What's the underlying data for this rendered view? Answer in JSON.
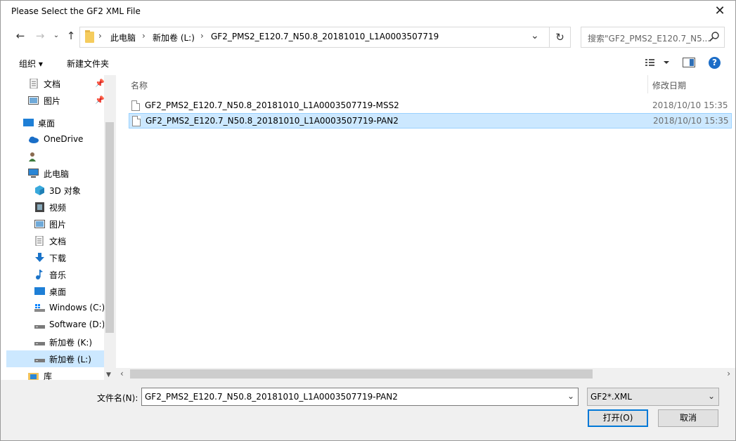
{
  "window": {
    "title": "Please Select the GF2 XML File"
  },
  "address": {
    "crumbs": [
      "此电脑",
      "新加卷 (L:)",
      "GF2_PMS2_E120.7_N50.8_20181010_L1A0003507719"
    ],
    "separator": "›",
    "search_placeholder": "搜索\"GF2_PMS2_E120.7_N5..."
  },
  "toolbar": {
    "organize": "组织 ▾",
    "new_folder": "新建文件夹"
  },
  "sidebar": {
    "items": [
      {
        "label": "文档",
        "icon": "document-icon",
        "pinned": true
      },
      {
        "label": "图片",
        "icon": "pictures-icon",
        "pinned": true
      },
      {
        "label": "桌面",
        "icon": "desktop-icon"
      },
      {
        "label": "OneDrive",
        "icon": "onedrive-icon"
      },
      {
        "label": "",
        "icon": "user-icon"
      },
      {
        "label": "此电脑",
        "icon": "this-pc-icon"
      },
      {
        "label": "3D 对象",
        "icon": "3d-objects-icon"
      },
      {
        "label": "视频",
        "icon": "videos-icon"
      },
      {
        "label": "图片",
        "icon": "pictures-icon"
      },
      {
        "label": "文档",
        "icon": "document-icon"
      },
      {
        "label": "下载",
        "icon": "download-icon"
      },
      {
        "label": "音乐",
        "icon": "music-icon"
      },
      {
        "label": "桌面",
        "icon": "desktop-icon"
      },
      {
        "label": "Windows (C:)",
        "icon": "drive-icon"
      },
      {
        "label": "Software (D:)",
        "icon": "drive-icon"
      },
      {
        "label": "新加卷 (K:)",
        "icon": "drive-icon"
      },
      {
        "label": "新加卷 (L:)",
        "icon": "drive-icon",
        "selected": true
      },
      {
        "label": "库",
        "icon": "library-icon"
      }
    ]
  },
  "files": {
    "col_name": "名称",
    "col_date": "修改日期",
    "rows": [
      {
        "name": "GF2_PMS2_E120.7_N50.8_20181010_L1A0003507719-MSS2",
        "date": "2018/10/10 15:35",
        "selected": false
      },
      {
        "name": "GF2_PMS2_E120.7_N50.8_20181010_L1A0003507719-PAN2",
        "date": "2018/10/10 15:35",
        "selected": true
      }
    ]
  },
  "footer": {
    "filename_label": "文件名(N):",
    "filename_value": "GF2_PMS2_E120.7_N50.8_20181010_L1A0003507719-PAN2",
    "filetype_value": "GF2*.XML",
    "open_label": "打开(O)",
    "cancel_label": "取消"
  },
  "colors": {
    "selection": "#cce8ff",
    "accent": "#0078d7"
  }
}
